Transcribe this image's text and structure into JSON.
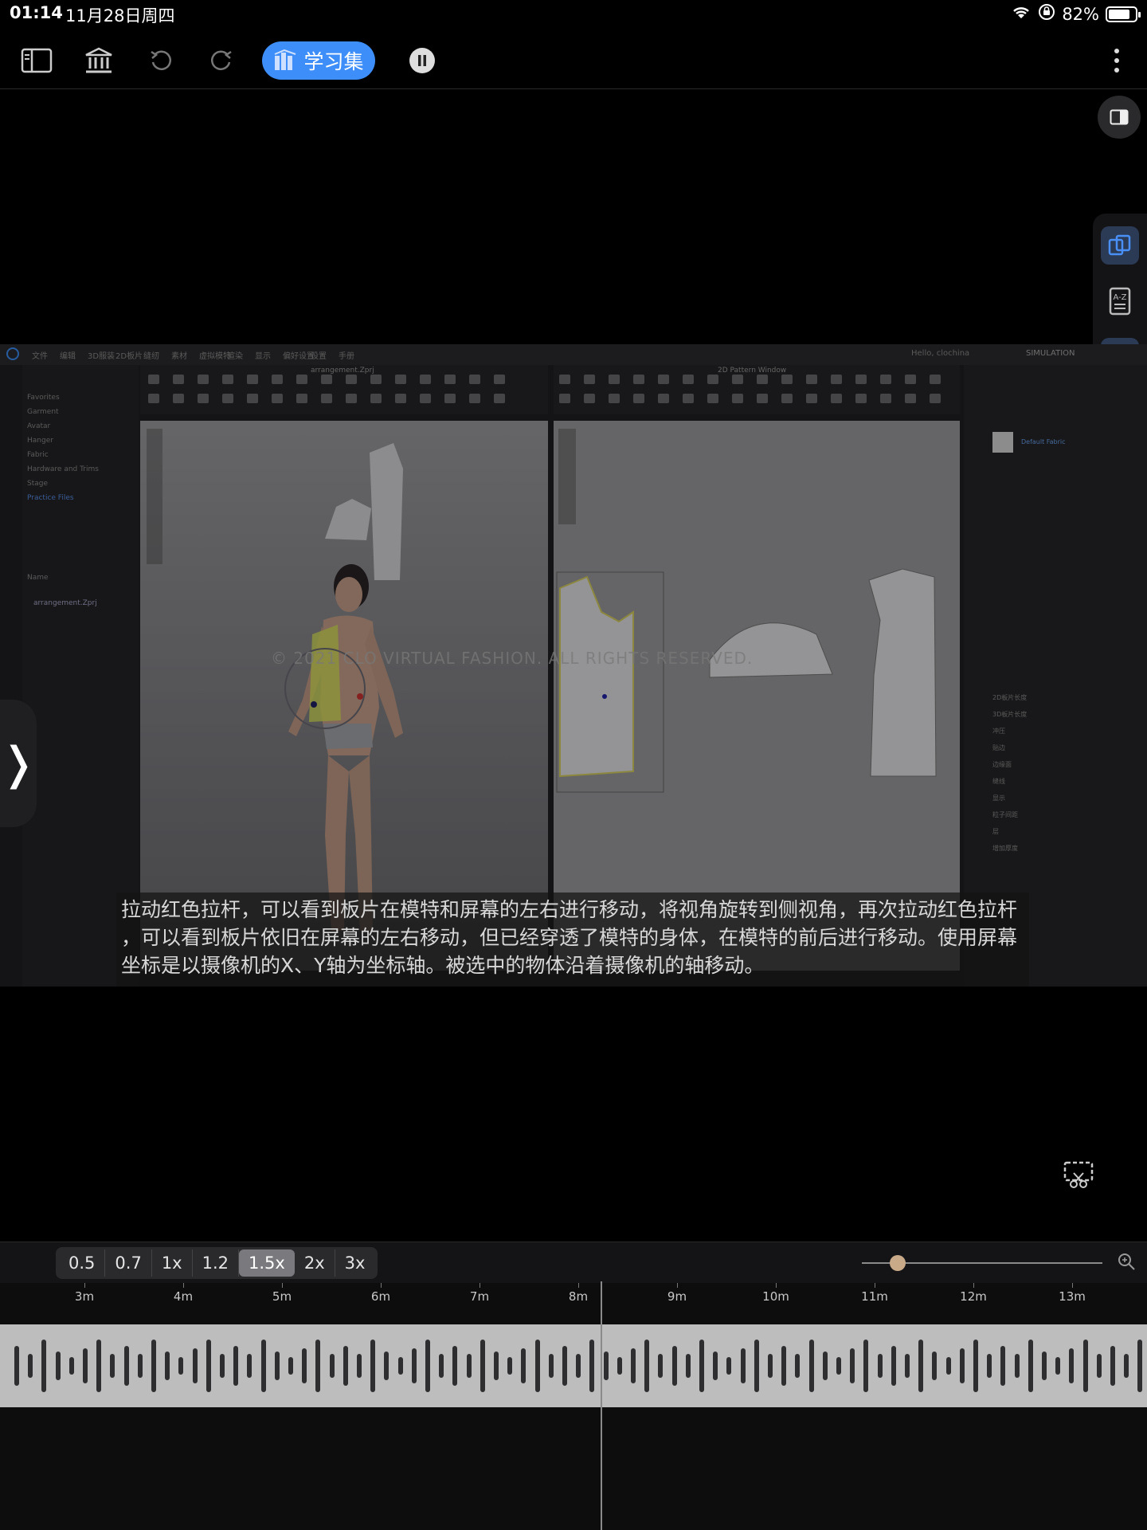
{
  "status_bar": {
    "time": "01:14",
    "date": "11月28日周四",
    "battery_pct": 0.82,
    "battery_label": "82%"
  },
  "toolbar": {
    "study_set_label": "学习集",
    "icons": [
      "sidebar-icon",
      "library-icon",
      "undo-icon",
      "redo-icon",
      "pause-icon",
      "more-icon"
    ]
  },
  "side_tools": [
    "copy-pages-icon",
    "dictionary-icon",
    "search-icon",
    "refresh-icon"
  ],
  "video": {
    "app_menus": [
      "文件",
      "编辑",
      "3D服装",
      "2D板片",
      "缝纫",
      "素材",
      "虚拟模特",
      "渲染",
      "显示",
      "偏好设置",
      "设置",
      "手册"
    ],
    "user_greeting": "Hello, clochina",
    "mode_label": "SIMULATION",
    "viewport_title": "arrangement.Zprj",
    "pattern_window_title": "2D Pattern Window",
    "library_items": [
      "Favorites",
      "Garment",
      "Avatar",
      "Hanger",
      "Fabric",
      "Hardware and Trims",
      "Stage",
      "Practice Files"
    ],
    "file_header": "Name",
    "file_name": "arrangement.Zprj",
    "fabric_name": "Default Fabric",
    "props": [
      "2D板片长度",
      "3D板片长度",
      "冲压",
      "贴边",
      "边缘面",
      "缝线",
      "显示",
      "粒子间距",
      "层",
      "增加厚度"
    ],
    "watermark": "© 2021 CLO VIRTUAL FASHION. ALL RIGHTS RESERVED.",
    "subtitle": "拉动红色拉杆，可以看到板片在模特和屏幕的左右进行移动，将视角旋转到侧视角，再次拉动红色拉杆 ，可以看到板片依旧在屏幕的左右移动，但已经穿透了模特的身体，在模特的前后进行移动。使用屏幕坐标是以摄像机的X、Y轴为坐标轴。被选中的物体沿着摄像机的轴移动。"
  },
  "speed_options": [
    "0.5",
    "0.7",
    "1x",
    "1.2",
    "1.5x",
    "2x",
    "3x"
  ],
  "speed_selected": "1.5x",
  "zoom_level": 0.15,
  "timeline": {
    "ticks": [
      "3m",
      "4m",
      "5m",
      "6m",
      "7m",
      "8m",
      "9m",
      "10m",
      "11m",
      "12m",
      "13m"
    ]
  }
}
